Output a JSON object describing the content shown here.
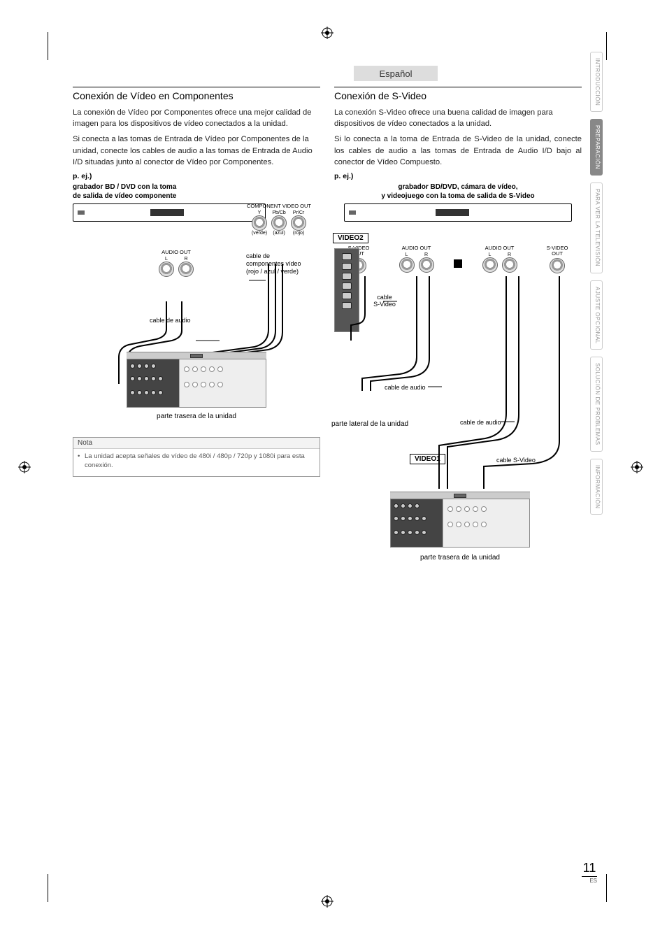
{
  "language_tab": "Español",
  "left": {
    "heading": "Conexión de Vídeo en Componentes",
    "p1": "La conexión de Vídeo por Componentes ofrece una mejor calidad de imagen para los dispositivos de vídeo conectados a la unidad.",
    "p2": "Si conecta a las tomas de Entrada de Vídeo por Componentes de la unidad, conecte los cables de audio a las tomas de Entrada de Audio I/D situadas junto al conector de Vídeo por Componentes.",
    "eg": "p. ej.)",
    "device_label": "grabador BD / DVD con la toma\nde salida de vídeo componente",
    "component_out_label": "COMPONENT VIDEO OUT",
    "component_channels": {
      "y": "Y",
      "pb": "Pb/Cb",
      "pr": "Pr/Cr"
    },
    "component_colors": {
      "y": "(verde)",
      "pb": "(azul)",
      "pr": "(rojo)"
    },
    "audio_out_label": "AUDIO OUT",
    "audio_lr": {
      "l": "L",
      "r": "R"
    },
    "cable_component": "cable de\ncomponentes vídeo\n(rojo / azul / verde)",
    "cable_audio": "cable de audio",
    "rear_caption": "parte trasera de la unidad",
    "note_title": "Nota",
    "note_body": "La unidad acepta señales de vídeo de 480i / 480p / 720p y 1080i para esta conexión."
  },
  "right": {
    "heading": "Conexión de S-Video",
    "p1": "La conexión S-Video ofrece una buena calidad de imagen para dispositivos de vídeo conectados a la unidad.",
    "p2": "Si lo conecta a la toma de Entrada de S-Video de la unidad, conecte los cables de audio a las tomas de Entrada de Audio I/D bajo al conector de Vídeo Compuesto.",
    "eg": "p. ej.)",
    "device_label": "grabador BD/DVD, cámara de vídeo,\ny videojuego con la toma de salida de S-Video",
    "video2": "VIDEO2",
    "video1": "VIDEO1",
    "svideo_out": "S-VIDEO\nOUT",
    "audio_out": "AUDIO OUT",
    "audio_lr": {
      "l": "L",
      "r": "R"
    },
    "cable_svideo": "cable\nS-Video",
    "cable_svideo2": "cable S-Video",
    "cable_audio": "cable de audio",
    "side_caption": "parte lateral de la unidad",
    "rear_caption": "parte trasera de la unidad"
  },
  "side_tabs": [
    {
      "label": "INTRODUCCIÓN",
      "active": false
    },
    {
      "label": "PREPARACIÓN",
      "active": true
    },
    {
      "label": "PARA VER LA TELEVISIÓN",
      "active": false
    },
    {
      "label": "AJUSTE OPCIONAL",
      "active": false
    },
    {
      "label": "SOLUCIÓN DE PROBLEMAS",
      "active": false
    },
    {
      "label": "INFORMACIÓN",
      "active": false
    }
  ],
  "page_number": "11",
  "page_lang_code": "ES"
}
